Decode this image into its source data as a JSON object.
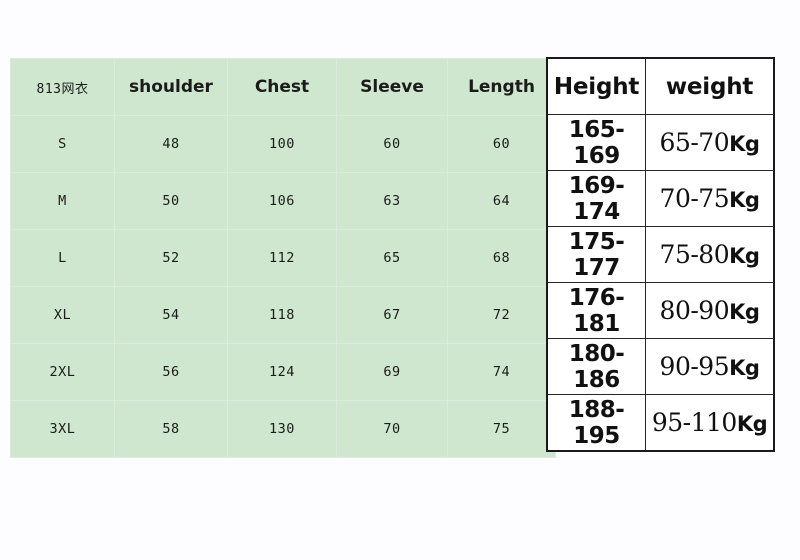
{
  "size_table": {
    "headers": [
      "813网衣",
      "shoulder",
      "Chest",
      "Sleeve",
      "Length"
    ],
    "rows": [
      {
        "size": "S",
        "shoulder": "48",
        "chest": "100",
        "sleeve": "60",
        "length": "60"
      },
      {
        "size": "M",
        "shoulder": "50",
        "chest": "106",
        "sleeve": "63",
        "length": "64"
      },
      {
        "size": "L",
        "shoulder": "52",
        "chest": "112",
        "sleeve": "65",
        "length": "68"
      },
      {
        "size": "XL",
        "shoulder": "54",
        "chest": "118",
        "sleeve": "67",
        "length": "72"
      },
      {
        "size": "2XL",
        "shoulder": "56",
        "chest": "124",
        "sleeve": "69",
        "length": "74"
      },
      {
        "size": "3XL",
        "shoulder": "58",
        "chest": "130",
        "sleeve": "70",
        "length": "75"
      }
    ]
  },
  "hw_table": {
    "headers": [
      "Height",
      "weight"
    ],
    "rows": [
      {
        "height": "165-169",
        "weight": "65-70",
        "unit": "Kg"
      },
      {
        "height": "169-174",
        "weight": "70-75",
        "unit": "Kg"
      },
      {
        "height": "175-177",
        "weight": "75-80",
        "unit": "Kg"
      },
      {
        "height": "176-181",
        "weight": "80-90",
        "unit": "Kg"
      },
      {
        "height": "180-186",
        "weight": "90-95",
        "unit": "Kg"
      },
      {
        "height": "188-195",
        "weight": "95-110",
        "unit": "Kg"
      }
    ]
  },
  "colors": {
    "table_green": "#cfe7cf",
    "grid_green": "#dcecdc",
    "page_background": "#fdfdff",
    "hw_border": "#262626",
    "text": "#1b1b1b"
  }
}
